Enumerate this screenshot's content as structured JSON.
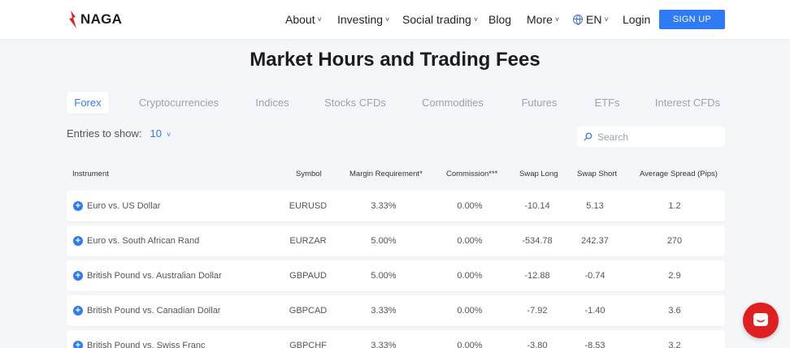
{
  "header": {
    "logo_text": "NAGA",
    "nav": [
      {
        "label": "About",
        "dropdown": true
      },
      {
        "label": "Investing",
        "dropdown": true
      },
      {
        "label": "Social trading",
        "dropdown": true
      },
      {
        "label": "Blog",
        "dropdown": false
      },
      {
        "label": "More",
        "dropdown": true
      }
    ],
    "language": "EN",
    "login": "Login",
    "signup": "SIGN UP"
  },
  "page_title": "Market Hours and Trading Fees",
  "tabs": [
    "Forex",
    "Cryptocurrencies",
    "Indices",
    "Stocks CFDs",
    "Commodities",
    "Futures",
    "ETFs",
    "Interest CFDs"
  ],
  "active_tab": "Forex",
  "entries": {
    "label": "Entries to show:",
    "value": "10"
  },
  "search": {
    "placeholder": "Search"
  },
  "table": {
    "headers": [
      "Instrument",
      "Symbol",
      "Margin Requirement*",
      "Commission***",
      "Swap Long",
      "Swap Short",
      "Average Spread (Pips)"
    ],
    "rows": [
      [
        "Euro vs. US Dollar",
        "EURUSD",
        "3.33%",
        "0.00%",
        "-10.14",
        "5.13",
        "1.2"
      ],
      [
        "Euro vs. South African Rand",
        "EURZAR",
        "5.00%",
        "0.00%",
        "-534.78",
        "242.37",
        "270"
      ],
      [
        "British Pound vs. Australian Dollar",
        "GBPAUD",
        "5.00%",
        "0.00%",
        "-12.88",
        "-0.74",
        "2.9"
      ],
      [
        "British Pound vs. Canadian Dollar",
        "GBPCAD",
        "3.33%",
        "0.00%",
        "-7.92",
        "-1.40",
        "3.6"
      ],
      [
        "British Pound vs. Swiss Franc",
        "GBPCHF",
        "3.33%",
        "0.00%",
        "-3.80",
        "-8.53",
        "3.2"
      ]
    ]
  },
  "colors": {
    "accent": "#2f7bf5",
    "brand_red": "#e02020",
    "background": "#f4f6fa"
  },
  "icons": {
    "logo": "flame-logo-icon",
    "language": "globe-icon",
    "search": "search-icon",
    "expand": "plus-circle-icon",
    "chat": "chat-icon"
  }
}
